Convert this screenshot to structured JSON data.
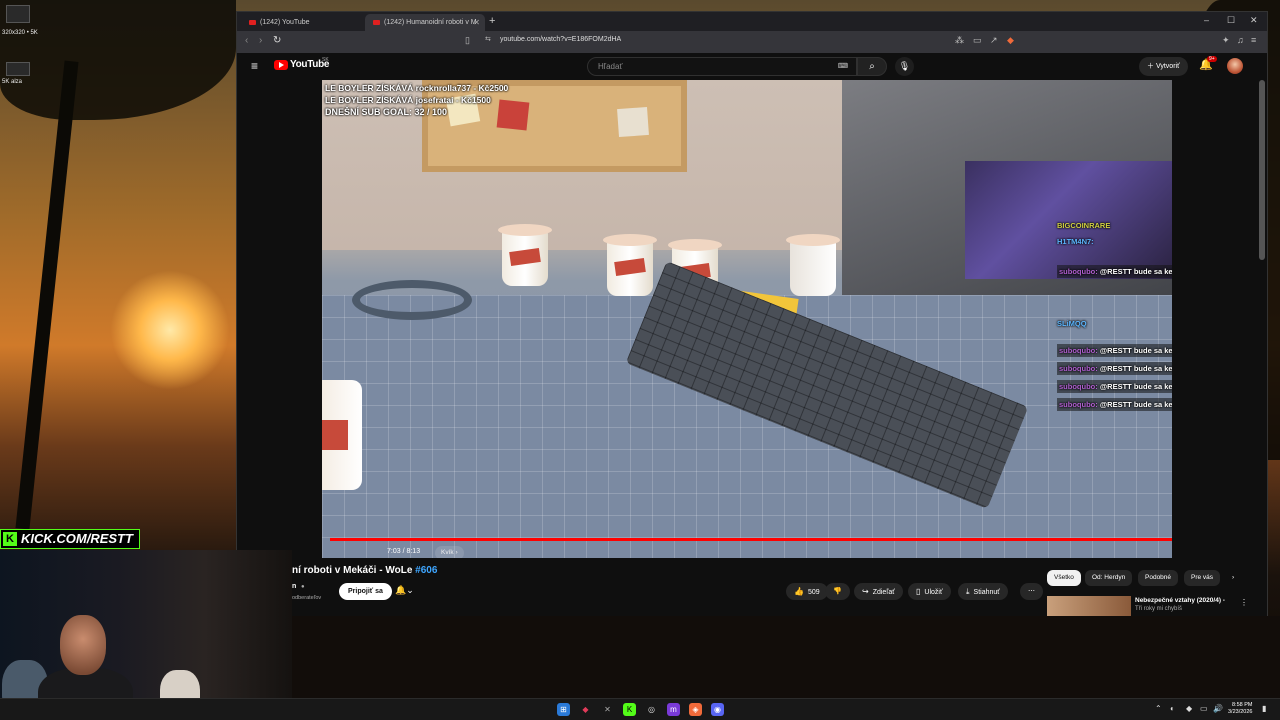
{
  "desktop": {
    "icons": [
      {
        "label": "320x320 • 5K"
      },
      {
        "label": "5K alza"
      }
    ]
  },
  "browser": {
    "tabs": [
      {
        "label": "(1242) YouTube"
      },
      {
        "label": "(1242) Humanoidní roboti v M"
      }
    ],
    "new_tab": "+",
    "url": "youtube.com/watch?v=E186FOM2dHA",
    "window_controls": {
      "minimize": "–",
      "maximize": "☐",
      "close": "✕"
    }
  },
  "youtube": {
    "logo_text": "YouTube",
    "country": "SK",
    "search_placeholder": "Hľadať",
    "create_label": "Vytvoriť",
    "notification_count": "9+"
  },
  "video": {
    "overlay_lines": [
      "LE BOYLER ZÍSKÁVÁ rocknrolla737 - Kč2500",
      "LE BOYLER ZÍSKÁVÁ josefratai - Kč1500",
      "DNEŠNÍ SUB GOAL: 32 / 100"
    ],
    "chat": [
      {
        "user": "BIGCOINRARE",
        "text": ""
      },
      {
        "user": "H1TM4N7:",
        "text": ""
      },
      {
        "user": "",
        "text": ""
      },
      {
        "user": "suboqubo:",
        "text": "@RESTT bude sa kedy nieco hrat?"
      },
      {
        "user": "",
        "text": ""
      },
      {
        "user": "SLiMQQ",
        "text": ""
      },
      {
        "user": "suboqubo:",
        "text": "@RESTT bude sa kedy nieco hrat?"
      },
      {
        "user": "suboqubo:",
        "text": "@RESTT bude sa kedy nieco hrat?"
      },
      {
        "user": "suboqubo:",
        "text": "@RESTT bude sa kedy nieco hrat?"
      },
      {
        "user": "suboqubo:",
        "text": "@RESTT bude sa kedy nieco hrat?"
      }
    ],
    "time": "7:03 / 8:13",
    "chapter": "Kvík",
    "progress_fraction": 0.93
  },
  "details": {
    "title": "ní roboti v Mekáči - WoLe",
    "tag": "#606",
    "channel_initial": "n",
    "subs_text": "odberateľov",
    "join_label": "Pripojiť sa",
    "like_count": "509",
    "share_label": "Zdieľať",
    "save_label": "Uložiť",
    "download_label": "Stiahnuť"
  },
  "sidebar": {
    "chips": [
      "Všetko",
      "Od: Herdyn",
      "Podobné",
      "Pre vás"
    ],
    "rec_title": "Nebezpečné vztahy (2020/4) -",
    "rec_sub": "Tři roky mi chybíš"
  },
  "overlay": {
    "kick_label": "KICK.COM/RESTT"
  },
  "taskbar": {
    "time": "8:58 PM",
    "date": "3/23/2026"
  }
}
